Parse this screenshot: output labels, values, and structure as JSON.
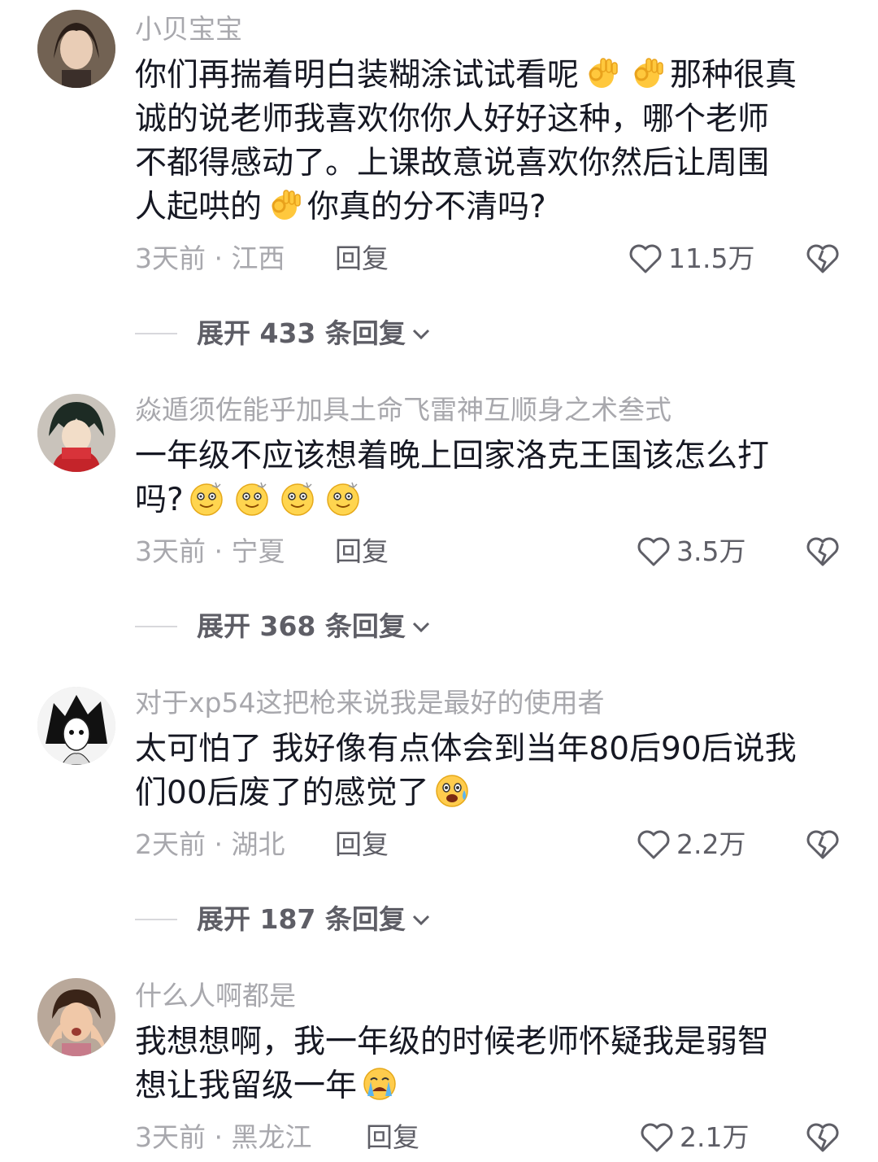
{
  "comments": [
    {
      "username": "小贝宝宝",
      "lines": [
        "你们再揣着明白装糊涂试试看呢",
        "那种很真",
        "诚的说老师我喜欢你你人好好这种，哪个老师",
        "不都得感动了。上课故意说喜欢你然后让周围",
        "人起哄的",
        "你真的分不清吗?"
      ],
      "time_location": "3天前 · 江西",
      "reply_label": "回复",
      "likes": "11.5万",
      "expand_label": "展开 433 条回复"
    },
    {
      "username": "焱遁须佐能乎加具土命飞雷神互顺身之术叁式",
      "lines": [
        "一年级不应该想着晚上回家洛克王国该怎么打",
        "吗?"
      ],
      "time_location": "3天前 · 宁夏",
      "reply_label": "回复",
      "likes": "3.5万",
      "expand_label": "展开 368 条回复"
    },
    {
      "username": "对于xp54这把枪来说我是最好的使用者",
      "lines": [
        "太可怕了 我好像有点体会到当年80后90后说我",
        "们00后废了的感觉了"
      ],
      "time_location": "2天前 · 湖北",
      "reply_label": "回复",
      "likes": "2.2万",
      "expand_label": "展开 187 条回复"
    },
    {
      "username": "什么人啊都是",
      "lines": [
        "我想想啊，我一年级的时候老师怀疑我是弱智",
        "想让我留级一年"
      ],
      "time_location": "3天前 · 黑龙江",
      "reply_label": "回复",
      "likes": "2.1万"
    }
  ],
  "icons": {
    "ok_hand": "ok-hand-emoji",
    "dizzy_smile": "dizzy-smile-emoji",
    "scared": "scared-emoji",
    "crying": "crying-emoji",
    "like": "heart-outline-icon",
    "dislike": "broken-heart-icon",
    "expand": "chevron-down-icon"
  },
  "colors": {
    "text": "#161823",
    "muted": "#a8a8ad",
    "action": "#5e5e66"
  }
}
